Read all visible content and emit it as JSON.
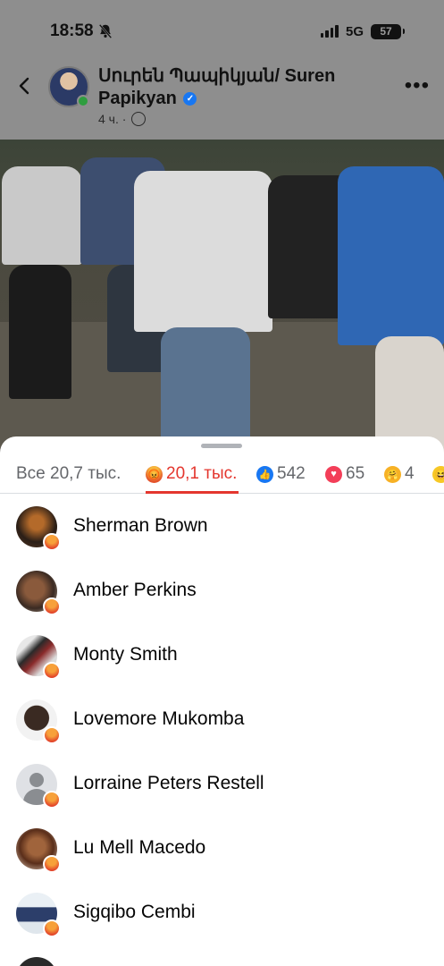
{
  "status_bar": {
    "time": "18:58",
    "network": "5G",
    "battery": "57"
  },
  "post": {
    "author": "Սուրեն Պապիկյան/ Suren Papikyan",
    "time_ago": "4 ч. ·",
    "icons": [
      "back-icon",
      "verified-icon",
      "globe-icon",
      "more-icon"
    ]
  },
  "reactions": {
    "tabs": [
      {
        "label": "Все 20,7 тыс.",
        "icon": ""
      },
      {
        "label": "20,1 тыс.",
        "icon": "angry-icon"
      },
      {
        "label": "542",
        "icon": "like-icon"
      },
      {
        "label": "65",
        "icon": "love-icon"
      },
      {
        "label": "4",
        "icon": "care-icon"
      },
      {
        "label": "",
        "icon": "haha-icon"
      }
    ],
    "active_tab": 1,
    "accent_color": "#e4362e",
    "people": [
      {
        "name": "Sherman Brown"
      },
      {
        "name": "Amber Perkins"
      },
      {
        "name": "Monty Smith"
      },
      {
        "name": "Lovemore Mukomba"
      },
      {
        "name": "Lorraine Peters Restell"
      },
      {
        "name": "Lu Mell Macedo"
      },
      {
        "name": "Sigqibo Cembi"
      }
    ]
  }
}
